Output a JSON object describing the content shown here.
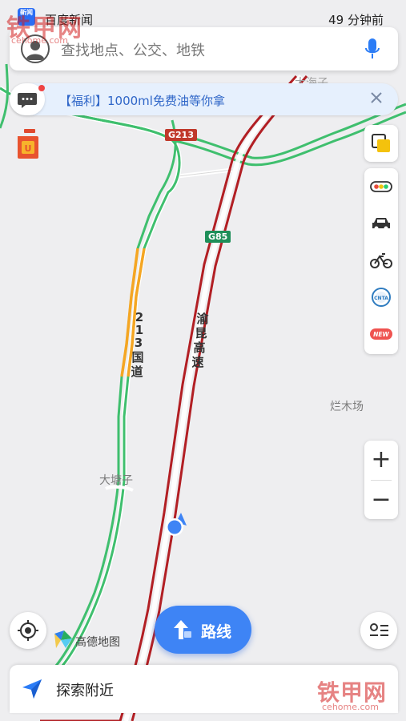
{
  "status_bar": {
    "news_icon_text": "新闻",
    "app_name": "百度新闻",
    "time_ago": "49 分钟前"
  },
  "search": {
    "placeholder": "查找地点、公交、地铁",
    "avatar_icon": "user-avatar-icon",
    "voice_icon": "microphone-icon"
  },
  "promo": {
    "text": "【福利】1000ml免费油等你拿",
    "message_icon": "chat-bubble-icon",
    "close_icon": "close-icon"
  },
  "map_labels": {
    "g213": "G213",
    "g85": "G85",
    "road_213": [
      "2",
      "1",
      "3",
      "国",
      "道"
    ],
    "expressway": [
      "渝",
      "昆",
      "高",
      "速"
    ],
    "place_top": "大海子",
    "place_right": "烂木场",
    "place_left": "大塘子"
  },
  "right_tools": [
    {
      "name": "layers-icon"
    },
    {
      "name": "traffic-light-icon"
    },
    {
      "name": "taxi-icon"
    },
    {
      "name": "bike-icon"
    },
    {
      "name": "cnta-badge-icon"
    },
    {
      "name": "new-badge",
      "text": "NEW"
    }
  ],
  "zoom": {
    "in": "+",
    "out": "−"
  },
  "bottom": {
    "route_label": "路线",
    "logo_text": "高德地图",
    "nearby_label": "探索附近",
    "locate_icon": "crosshair-icon",
    "list_icon": "route-list-icon",
    "nearby_icon": "paper-plane-icon"
  },
  "watermark": {
    "top_title": "铁甲网",
    "top_url": "cehome.com",
    "bottom_title": "铁甲网",
    "bottom_url": "cehome.com"
  },
  "colors": {
    "expressway": "#b21f24",
    "national_road": "#3fbf6e",
    "slow_segment": "#f5a623",
    "accent": "#3e84f5"
  }
}
